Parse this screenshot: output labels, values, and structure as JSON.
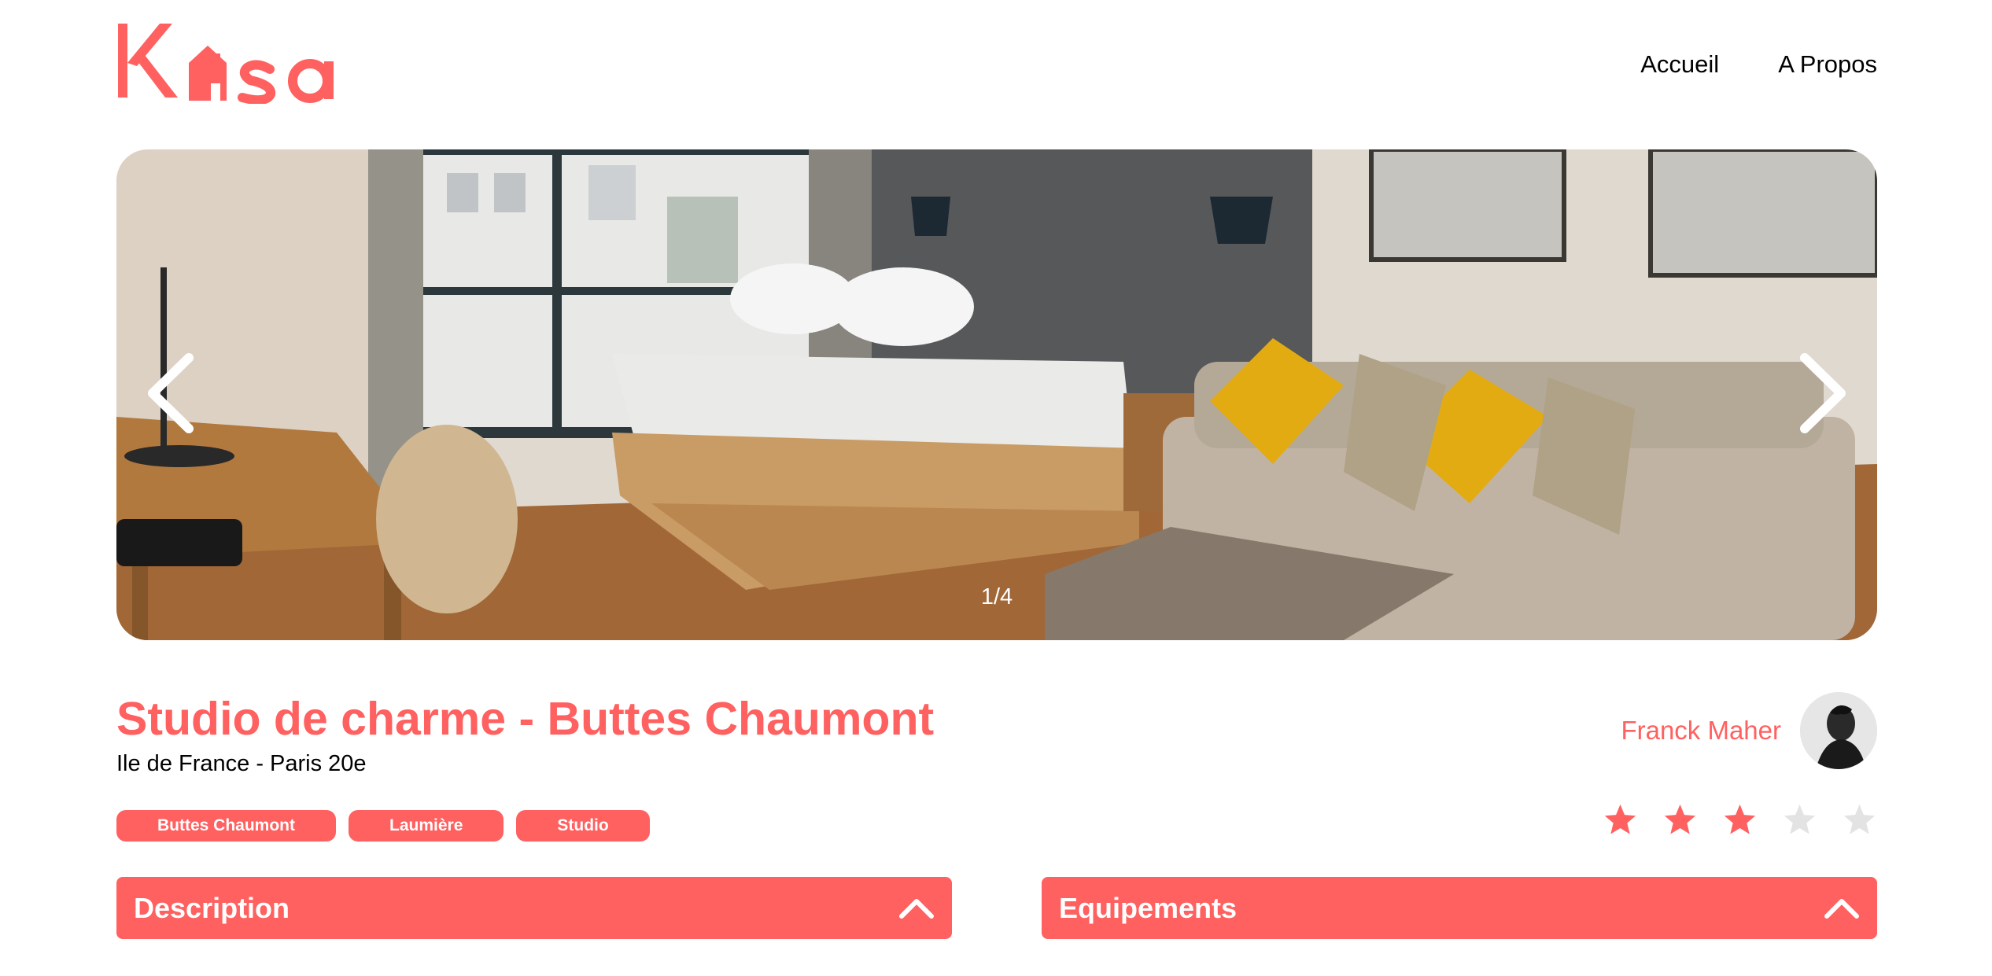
{
  "logo": {
    "text": "Kasa",
    "color": "#FF6060"
  },
  "nav": {
    "home": "Accueil",
    "about": "A Propos"
  },
  "carousel": {
    "counter": "1/4",
    "prev_icon": "chevron-left-icon",
    "next_icon": "chevron-right-icon"
  },
  "listing": {
    "title": "Studio de charme - Buttes Chaumont",
    "location": "Ile de France - Paris 20e",
    "tags": [
      "Buttes Chaumont",
      "Laumière",
      "Studio"
    ]
  },
  "host": {
    "name": "Franck Maher"
  },
  "rating": {
    "value": 3,
    "max": 5,
    "active_color": "#FF6060",
    "inactive_color": "#E3E3E3"
  },
  "collapses": {
    "description": "Description",
    "equipements": "Equipements"
  }
}
